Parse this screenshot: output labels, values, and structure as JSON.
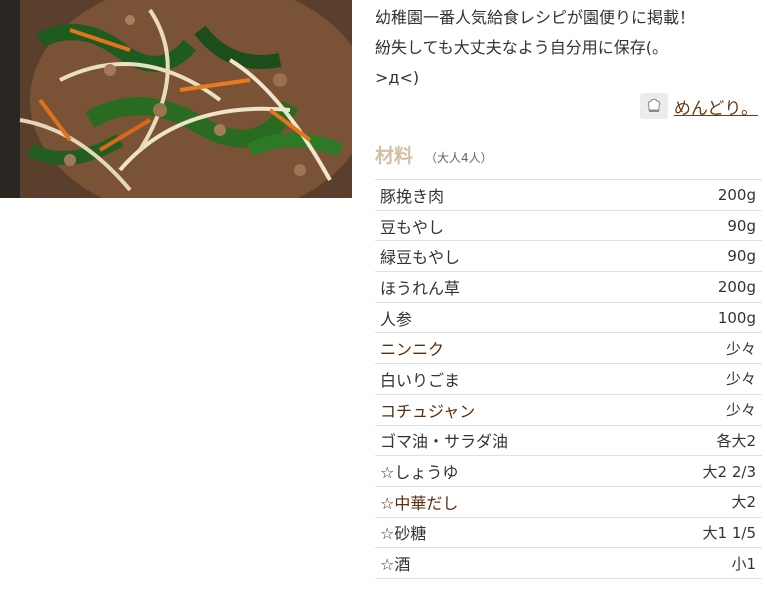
{
  "recipe": {
    "description": "幼稚園一番人気給食レシピが園便りに掲載！\n紛失しても大丈夫なよう自分用に保存(。\n>д<)",
    "author_name": "めんどり。",
    "author_icon": "chef-avatar-icon",
    "photo_alt": "ナムル風そぼろ炒め"
  },
  "ingredients": {
    "title": "材料",
    "serving": "（大人4人）",
    "items": [
      {
        "name": "豚挽き肉",
        "qty": "200g",
        "link": false
      },
      {
        "name": "豆もやし",
        "qty": "90g",
        "link": false
      },
      {
        "name": "緑豆もやし",
        "qty": "90g",
        "link": false
      },
      {
        "name": "ほうれん草",
        "qty": "200g",
        "link": false
      },
      {
        "name": "人参",
        "qty": "100g",
        "link": false
      },
      {
        "name": "ニンニク",
        "qty": "少々",
        "link": true
      },
      {
        "name": "白いりごま",
        "qty": "少々",
        "link": false
      },
      {
        "name": "コチュジャン",
        "qty": "少々",
        "link": true
      },
      {
        "name": "ゴマ油・サラダ油",
        "qty": "各大2",
        "link": false
      },
      {
        "name": "☆しょうゆ",
        "qty": "大2 2/3",
        "link": false
      },
      {
        "name": "☆中華だし",
        "qty": "大2",
        "link": true
      },
      {
        "name": "☆砂糖",
        "qty": "大1 1/5",
        "link": false
      },
      {
        "name": "☆酒",
        "qty": "小1",
        "link": false
      }
    ]
  },
  "colors": {
    "title": "#d3c0a4",
    "link": "#5a2d0c",
    "row_border": "#e2e2e2"
  }
}
